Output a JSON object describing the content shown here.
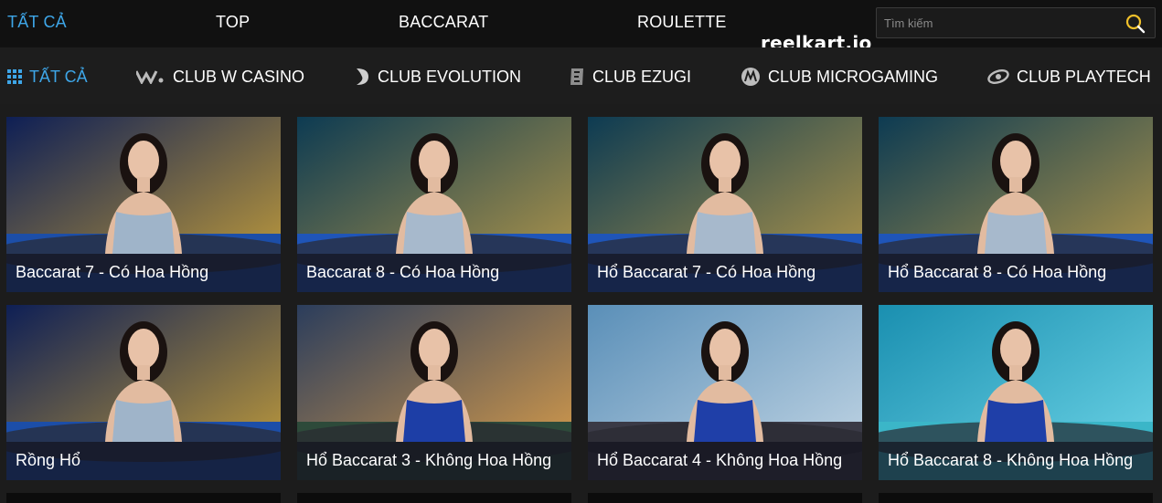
{
  "topnav": {
    "tabs": [
      {
        "label": "TẤT CẢ",
        "active": true
      },
      {
        "label": "TOP",
        "active": false
      },
      {
        "label": "BACCARAT",
        "active": false
      },
      {
        "label": "ROULETTE",
        "active": false
      }
    ],
    "search_placeholder": "Tìm kiếm",
    "watermark": "reelkart.io"
  },
  "providers": [
    {
      "label": "TẤT CẢ",
      "icon": "grid-icon",
      "active": true
    },
    {
      "label": "CLUB W CASINO",
      "icon": "w-casino-logo-icon",
      "active": false
    },
    {
      "label": "CLUB EVOLUTION",
      "icon": "evolution-logo-icon",
      "active": false
    },
    {
      "label": "CLUB EZUGI",
      "icon": "ezugi-logo-icon",
      "active": false
    },
    {
      "label": "CLUB MICROGAMING",
      "icon": "microgaming-logo-icon",
      "active": false
    },
    {
      "label": "CLUB PLAYTECH",
      "icon": "playtech-logo-icon",
      "active": false
    }
  ],
  "games": [
    {
      "title": "Baccarat 7 - Có Hoa Hồng",
      "theme": "butterfly"
    },
    {
      "title": "Baccarat 8 - Có Hoa Hồng",
      "theme": "curtain"
    },
    {
      "title": "Hổ Baccarat 7 - Có Hoa Hồng",
      "theme": "curtain"
    },
    {
      "title": "Hổ Baccarat 8 - Có Hoa Hồng",
      "theme": "curtain"
    },
    {
      "title": "Rồng Hổ",
      "theme": "butterfly"
    },
    {
      "title": "Hổ Baccarat 3 - Không Hoa Hồng",
      "theme": "city"
    },
    {
      "title": "Hổ Baccarat 4 - Không Hoa Hồng",
      "theme": "sea"
    },
    {
      "title": "Hổ Baccarat 8 - Không Hoa Hồng",
      "theme": "aquarium"
    }
  ],
  "colors": {
    "accent": "#3ea6e8",
    "topnav_bg": "#111111",
    "provider_bg": "#1d1d1d"
  }
}
